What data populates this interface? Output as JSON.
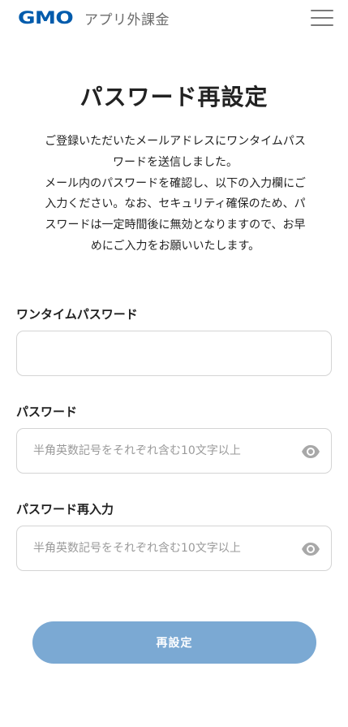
{
  "header": {
    "logo_brand": "GMO",
    "logo_service": "アプリ外課金",
    "menu_icon": "hamburger-menu-icon"
  },
  "page": {
    "title": "パスワード再設定",
    "description_lines": [
      "ご登録いただいたメールアドレスにワンタイムパス",
      "ワードを送信しました。",
      "メール内のパスワードを確認し、以下の入力欄にご",
      "入力ください。なお、セキュリティ確保のため、パ",
      "スワードは一定時間後に無効となりますので、お早",
      "めにご入力をお願いいたします。"
    ]
  },
  "form": {
    "one_time_password": {
      "label": "ワンタイムパスワード",
      "value": "",
      "placeholder": ""
    },
    "password": {
      "label": "パスワード",
      "value": "",
      "placeholder": "半角英数記号をそれぞれ含む10文字以上",
      "toggle_icon": "eye-icon"
    },
    "password_confirm": {
      "label": "パスワード再入力",
      "value": "",
      "placeholder": "半角英数記号をそれぞれ含む10文字以上",
      "toggle_icon": "eye-icon"
    },
    "submit_label": "再設定"
  },
  "colors": {
    "brand_blue": "#005bac",
    "button_bg": "#7ba9d3",
    "text": "#222222",
    "placeholder": "#9a9a9a",
    "border": "#d4d4d4",
    "icon_gray": "#a8a8a8"
  }
}
